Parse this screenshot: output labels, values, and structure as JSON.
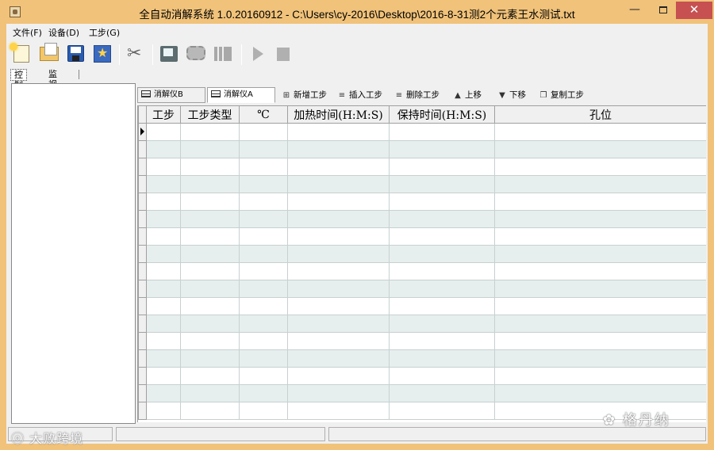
{
  "window": {
    "title": "全自动消解系统 1.0.20160912 - C:\\Users\\cy-2016\\Desktop\\2016-8-31测2个元素王水测试.txt",
    "minimize_label": "—",
    "close_label": "✕"
  },
  "menu": {
    "items": [
      {
        "label": "文件(F)"
      },
      {
        "label": "设备(D)"
      },
      {
        "label": "工步(G)"
      }
    ]
  },
  "toolbar": {
    "buttons": [
      {
        "icon": "new-file-icon"
      },
      {
        "icon": "open-folder-icon"
      },
      {
        "icon": "save-icon"
      },
      {
        "icon": "favorite-icon"
      },
      {
        "icon": "tools-icon"
      },
      {
        "icon": "scan-icon"
      },
      {
        "icon": "gear-icon"
      },
      {
        "icon": "bars-icon"
      },
      {
        "icon": "play-icon"
      },
      {
        "icon": "stop-icon"
      }
    ]
  },
  "tabs": [
    {
      "label": "控制",
      "active": true
    },
    {
      "label": "监视",
      "active": false
    }
  ],
  "sub_toolbar": {
    "digester_tabs": [
      {
        "label": "消解仪B",
        "active": false
      },
      {
        "label": "消解仪A",
        "active": true
      }
    ],
    "actions": [
      {
        "label": "新增工步",
        "icon": "add-step-icon"
      },
      {
        "label": "插入工步",
        "icon": "insert-step-icon"
      },
      {
        "label": "删除工步",
        "icon": "delete-step-icon"
      },
      {
        "label": "上移",
        "icon": "arrow-up-icon"
      },
      {
        "label": "下移",
        "icon": "arrow-down-icon"
      },
      {
        "label": "复制工步",
        "icon": "copy-step-icon"
      }
    ]
  },
  "table": {
    "columns": [
      "工步",
      "工步类型",
      "℃",
      "加热时间(H:M:S)",
      "保持时间(H:M:S)",
      "孔位"
    ],
    "row_count": 17
  },
  "watermarks": {
    "left": "大败跨境",
    "right": "格丹纳"
  },
  "colors": {
    "title_bar": "#f0c27a",
    "alt_row": "#e6eeee",
    "close_button": "#c75050"
  }
}
